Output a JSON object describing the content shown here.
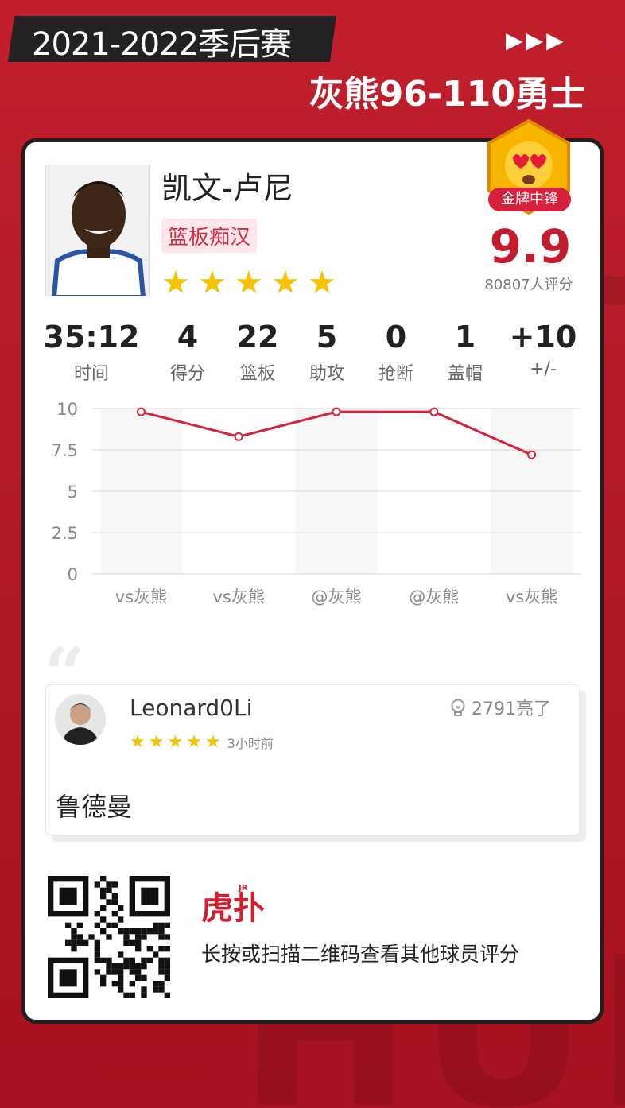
{
  "header": {
    "season": "2021-2022季后赛",
    "arrows": "▶▶▶",
    "score_title": "灰熊96-110勇士",
    "bg_letters": "HUPU"
  },
  "player": {
    "name": "凯文-卢尼",
    "tag": "篮板痴汉",
    "star_count": 5
  },
  "badge": {
    "label": "金牌中锋",
    "rating": "9.9",
    "rating_count": "80807人评分",
    "colors": {
      "gold": "#f7b500",
      "red": "#d7203b"
    }
  },
  "stats": [
    {
      "value": "35:12",
      "label": "时间"
    },
    {
      "value": "4",
      "label": "得分"
    },
    {
      "value": "22",
      "label": "篮板"
    },
    {
      "value": "5",
      "label": "助攻"
    },
    {
      "value": "0",
      "label": "抢断"
    },
    {
      "value": "1",
      "label": "盖帽"
    },
    {
      "value": "+10",
      "label": "+/-"
    }
  ],
  "chart_data": {
    "type": "line",
    "categories": [
      "vs灰熊",
      "vs灰熊",
      "@灰熊",
      "@灰熊",
      "vs灰熊"
    ],
    "series": [
      {
        "values": [
          9.8,
          8.3,
          9.8,
          9.8,
          7.2
        ]
      }
    ],
    "ylim": [
      0,
      10
    ],
    "yticks": [
      "10",
      "7.5",
      "5",
      "2.5",
      "0"
    ],
    "grid": true,
    "color": "#d7203b"
  },
  "comment": {
    "user": "Leonard0Li",
    "star_count": 5,
    "time": "3小时前",
    "likes": "2791亮了",
    "text": "鲁德曼"
  },
  "footer": {
    "logo": "虎扑",
    "logo_jr": "JR",
    "qr_text": "长按或扫描二维码查看其他球员评分"
  }
}
